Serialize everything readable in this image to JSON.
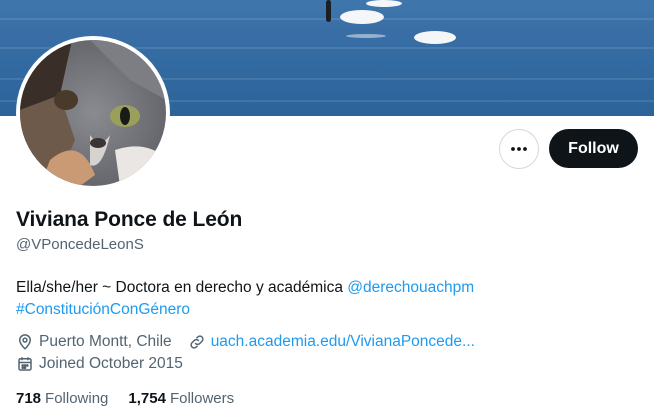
{
  "profile": {
    "name": "Viviana Ponce de León",
    "handle": "@VPoncedeLeonS",
    "bio_text": "Ella/she/her ~ Doctora en derecho y académica ",
    "bio_mention": "@derechouachpm",
    "bio_hashtag": "#ConstituciónConGénero",
    "location": "Puerto Montt, Chile",
    "website": "uach.academia.edu/VivianaPoncede...",
    "joined": "Joined October 2015",
    "following_count": "718",
    "following_label": "Following",
    "followers_count": "1,754",
    "followers_label": "Followers"
  },
  "actions": {
    "more_icon": "more-horizontal-icon",
    "follow_label": "Follow"
  },
  "icons": {
    "location": "location-pin-icon",
    "website": "link-icon",
    "joined": "calendar-icon"
  },
  "colors": {
    "link": "#1d9bf0",
    "primary_text": "#0f1419",
    "secondary_text": "#536471",
    "follow_button": "#0f1419"
  }
}
